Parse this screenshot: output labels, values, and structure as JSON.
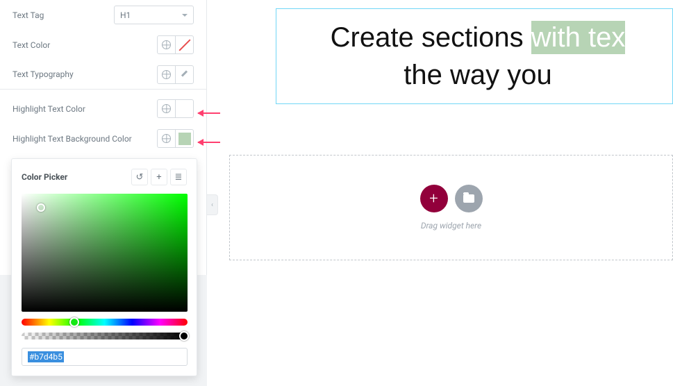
{
  "panel": {
    "text_tag_label": "Text Tag",
    "text_tag_value": "H1",
    "text_color_label": "Text Color",
    "text_typography_label": "Text Typography",
    "hl_color_label": "Highlight Text Color",
    "hl_bg_label": "Highlight Text Background Color"
  },
  "picker": {
    "title": "Color Picker",
    "hex": "#b7d4b5"
  },
  "canvas": {
    "heading_plain_1": "Create sections ",
    "heading_hl": "with tex",
    "heading_plain_2": "the way you ",
    "dropzone_hint": "Drag widget here"
  },
  "colors": {
    "hl_swatch": "#b7d4b5"
  }
}
